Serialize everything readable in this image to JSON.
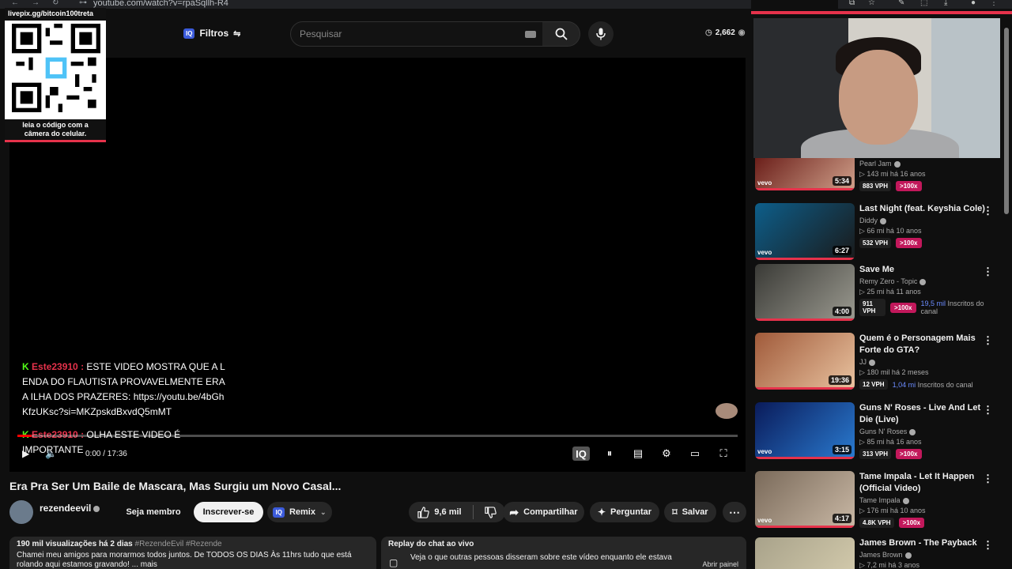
{
  "browser": {
    "url": "youtube.com/watch?v=rpaSqllh-R4"
  },
  "masthead": {
    "filters_label": "Filtros",
    "search_placeholder": "Pesquisar",
    "views_count": "2,662"
  },
  "qr_overlay": {
    "header": "livepix.gg/bitcoin100treta",
    "caption_line1": "leia o código com a",
    "caption_line2": "câmera do celular."
  },
  "chat_overlay": {
    "messages": [
      {
        "user": "Este23910 :",
        "text": "ESTE VIDEO MOSTRA QUE A LENDA DO FLAUTISTA PROVAVELMENTE ERA A ILHA DOS PRAZERES: https://youtu.be/4bGhKfzUKsc?si=MKZpskdBxvdQ5mMT"
      },
      {
        "user": "Este23910 :",
        "text": "OLHA ESTE VIDEO É IMPORTANTE"
      }
    ]
  },
  "player": {
    "time": "0:00 / 17:36",
    "progress": 0.02
  },
  "video": {
    "title": "Era Pra Ser Um Baile de Mascara, Mas Surgiu um Novo Casal...",
    "channel": "rezendeevil",
    "subscribers": "",
    "member_label": "Seja membro",
    "subscribe_label": "Inscrever-se",
    "remix_label": "Remix",
    "likes": "9,6 mil",
    "share_label": "Compartilhar",
    "ask_label": "Perguntar",
    "save_label": "Salvar",
    "views_meta": "190 mil visualizações  há 2 dias",
    "tags": "#RezendeEvil #Rezende",
    "description": "Chamei meu amigos para morarmos todos juntos. De TODOS OS DIAS Às 11hrs tudo que está rolando aqui estamos gravando! ... mais"
  },
  "chat_replay": {
    "title": "Replay do chat ao vivo",
    "description": "Veja o que outras pessoas disseram sobre este vídeo enquanto ele estava",
    "open_label": "Abrir painel"
  },
  "recommendations": [
    {
      "title": "",
      "channel": "Pearl Jam",
      "stats": "▷ 143 mi  há 16 anos",
      "duration": "5:34",
      "vph": "883 VPH",
      "mult": ">100x",
      "subs_note": "",
      "subs_value": "",
      "vevo": "vevo",
      "colors": [
        "#6b1f1a",
        "#d0a08a"
      ]
    },
    {
      "title": "Last Night (feat. Keyshia Cole)",
      "channel": "Diddy",
      "stats": "▷ 66 mi  há 10 anos",
      "duration": "6:27",
      "vph": "532 VPH",
      "mult": ">100x",
      "subs_note": "",
      "subs_value": "",
      "vevo": "vevo",
      "colors": [
        "#0d5e8a",
        "#1a1a1a"
      ]
    },
    {
      "title": "Save Me",
      "channel": "Remy Zero - Topic",
      "stats": "▷ 25 mi  há 11 anos",
      "duration": "4:00",
      "vph": "911 VPH",
      "mult": ">100x",
      "subs_note": "Inscritos do canal",
      "subs_value": "19,5 mil",
      "vevo": "",
      "colors": [
        "#3a3a36",
        "#9b9a90"
      ]
    },
    {
      "title": "Quem é o Personagem Mais Forte do GTA?",
      "channel": "JJ",
      "stats": "▷ 180 mil  há 2 meses",
      "duration": "19:36",
      "vph": "12 VPH",
      "mult": "",
      "subs_note": "Inscritos do canal",
      "subs_value": "1,04 mi",
      "vevo": "",
      "colors": [
        "#a05a3a",
        "#e9c3a0"
      ]
    },
    {
      "title": "Guns N' Roses - Live And Let Die (Live)",
      "channel": "Guns N' Roses",
      "stats": "▷ 85 mi  há 16 anos",
      "duration": "3:15",
      "vph": "313 VPH",
      "mult": ">100x",
      "subs_note": "",
      "subs_value": "",
      "vevo": "vevo",
      "colors": [
        "#0a1b5a",
        "#2a7bd0"
      ]
    },
    {
      "title": "Tame Impala - Let It Happen (Official Video)",
      "channel": "Tame Impala",
      "stats": "▷ 176 mi  há 10 anos",
      "duration": "4:17",
      "vph": "4.8K VPH",
      "mult": ">100x",
      "subs_note": "",
      "subs_value": "",
      "vevo": "vevo",
      "colors": [
        "#7a6a5a",
        "#c9b8a5"
      ]
    },
    {
      "title": "James Brown - The Payback",
      "channel": "James Brown",
      "stats": "▷ 7,2 mi  há 3 anos",
      "duration": "",
      "vph": "",
      "mult": "",
      "subs_note": "",
      "subs_value": "",
      "vevo": "",
      "colors": [
        "#a8a28a",
        "#d8cfb0"
      ]
    }
  ]
}
